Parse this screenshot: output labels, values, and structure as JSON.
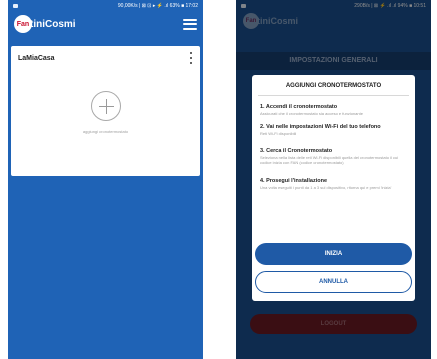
{
  "left_screen": {
    "status_bar": {
      "text": "90,00K/s | ⊠ ⊡ ▸ ⚡ .ıl 63% ■ 17:02"
    },
    "app_bar": {
      "logo_mark": "Fan",
      "logo_text": "tiniCosmi"
    },
    "home_card": {
      "title": "LaMiaCasa",
      "add_label": "aggiungi cronotermostato"
    }
  },
  "right_screen": {
    "status_bar": {
      "text": "290B/s | ⊠ ⚡ .ıl .ıl 94% ■ 10:51"
    },
    "background": {
      "logo_mark": "Fan",
      "logo_text": "tiniCosmi",
      "header": "IMPOSTAZIONI GENERALI",
      "logout": "LOGOUT"
    },
    "dialog": {
      "title": "AGGIUNGI CRONOTERMOSTATO",
      "steps": [
        {
          "title": "1. Accendi il cronotermostato",
          "desc": "Assicurati che il cronotermostato sia acceso e funzionante"
        },
        {
          "title": "2. Vai nelle impostazioni Wi-Fi del tuo telefono",
          "desc": "Reti Wi-Fi disponibili"
        },
        {
          "title": "3. Cerca il Cronotermostato",
          "desc": "Seleziona nella lista delle reti Wi-Fi disponibili quella del cronotermostato il cui codice inizia con FAN (codice cronotermostato)"
        },
        {
          "title": "4. Prosegui l'installazione",
          "desc": "Una volta eseguiti i punti da 1 a 3 sul dispositivo, ritorna qui e premi 'inizia'"
        }
      ],
      "primary_button": "INIZIA",
      "secondary_button": "ANNULLA"
    }
  },
  "colors": {
    "primary_blue": "#1f63b6",
    "button_blue": "#1f5aa6",
    "logo_red": "#c8102e"
  }
}
